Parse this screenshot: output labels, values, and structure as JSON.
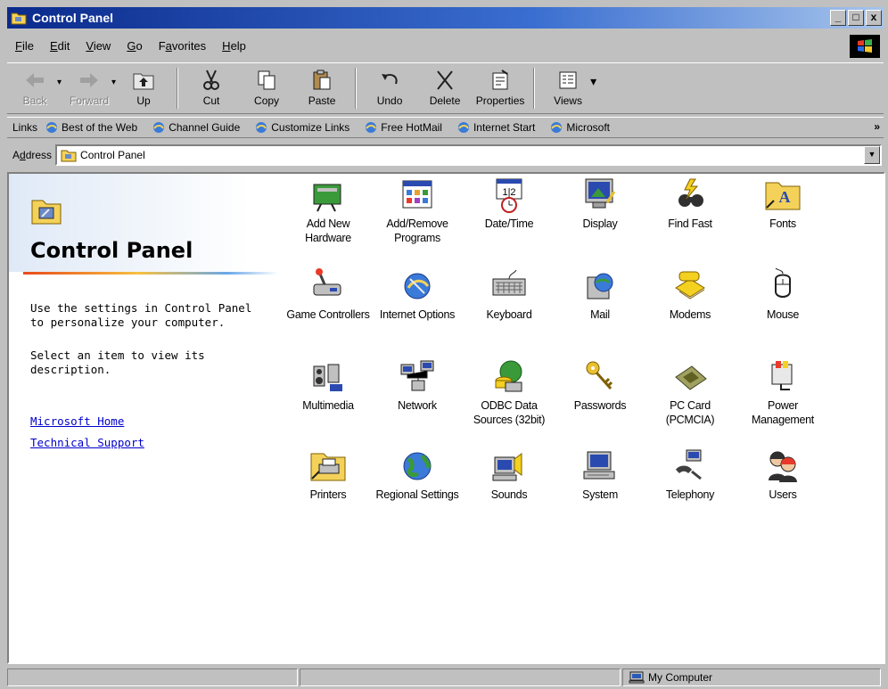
{
  "window": {
    "title": "Control Panel"
  },
  "titlebar_controls": [
    "_",
    "□",
    "x"
  ],
  "menu": [
    {
      "pre": "",
      "u": "F",
      "post": "ile"
    },
    {
      "pre": "",
      "u": "E",
      "post": "dit"
    },
    {
      "pre": "",
      "u": "V",
      "post": "iew"
    },
    {
      "pre": "",
      "u": "G",
      "post": "o"
    },
    {
      "pre": "F",
      "u": "a",
      "post": "vorites"
    },
    {
      "pre": "",
      "u": "H",
      "post": "elp"
    }
  ],
  "toolbar": {
    "back": "Back",
    "forward": "Forward",
    "up": "Up",
    "cut": "Cut",
    "copy": "Copy",
    "paste": "Paste",
    "undo": "Undo",
    "delete": "Delete",
    "properties": "Properties",
    "views": "Views"
  },
  "links": {
    "label": "Links",
    "items": [
      "Best of the Web",
      "Channel Guide",
      "Customize Links",
      "Free HotMail",
      "Internet Start",
      "Microsoft"
    ],
    "more": "»"
  },
  "address": {
    "label_pre": "A",
    "label_u": "d",
    "label_post": "dress",
    "value": "Control Panel"
  },
  "panel": {
    "title": "Control Panel",
    "description": "Use the settings in Control Panel to personalize your computer.",
    "hint": "Select an item to view its description.",
    "links": [
      "Microsoft Home",
      "Technical Support"
    ]
  },
  "items": [
    {
      "icon": "add-hardware-icon",
      "label": "Add New Hardware"
    },
    {
      "icon": "add-remove-programs-icon",
      "label": "Add/Remove Programs"
    },
    {
      "icon": "date-time-icon",
      "label": "Date/Time"
    },
    {
      "icon": "display-icon",
      "label": "Display"
    },
    {
      "icon": "find-fast-icon",
      "label": "Find Fast"
    },
    {
      "icon": "fonts-icon",
      "label": "Fonts"
    },
    {
      "icon": "game-controllers-icon",
      "label": "Game Controllers"
    },
    {
      "icon": "internet-options-icon",
      "label": "Internet Options"
    },
    {
      "icon": "keyboard-icon",
      "label": "Keyboard"
    },
    {
      "icon": "mail-icon",
      "label": "Mail"
    },
    {
      "icon": "modems-icon",
      "label": "Modems"
    },
    {
      "icon": "mouse-icon",
      "label": "Mouse"
    },
    {
      "icon": "multimedia-icon",
      "label": "Multimedia"
    },
    {
      "icon": "network-icon",
      "label": "Network"
    },
    {
      "icon": "odbc-icon",
      "label": "ODBC Data Sources (32bit)"
    },
    {
      "icon": "passwords-icon",
      "label": "Passwords"
    },
    {
      "icon": "pc-card-icon",
      "label": "PC Card (PCMCIA)"
    },
    {
      "icon": "power-management-icon",
      "label": "Power Management"
    },
    {
      "icon": "printers-icon",
      "label": "Printers"
    },
    {
      "icon": "regional-settings-icon",
      "label": "Regional Settings"
    },
    {
      "icon": "sounds-icon",
      "label": "Sounds"
    },
    {
      "icon": "system-icon",
      "label": "System"
    },
    {
      "icon": "telephony-icon",
      "label": "Telephony"
    },
    {
      "icon": "users-icon",
      "label": "Users"
    }
  ],
  "status": {
    "zone": "My Computer"
  },
  "colors": {
    "titlebar": "#0a2a8c",
    "face": "#c0c0c0",
    "link": "#0000cc"
  }
}
